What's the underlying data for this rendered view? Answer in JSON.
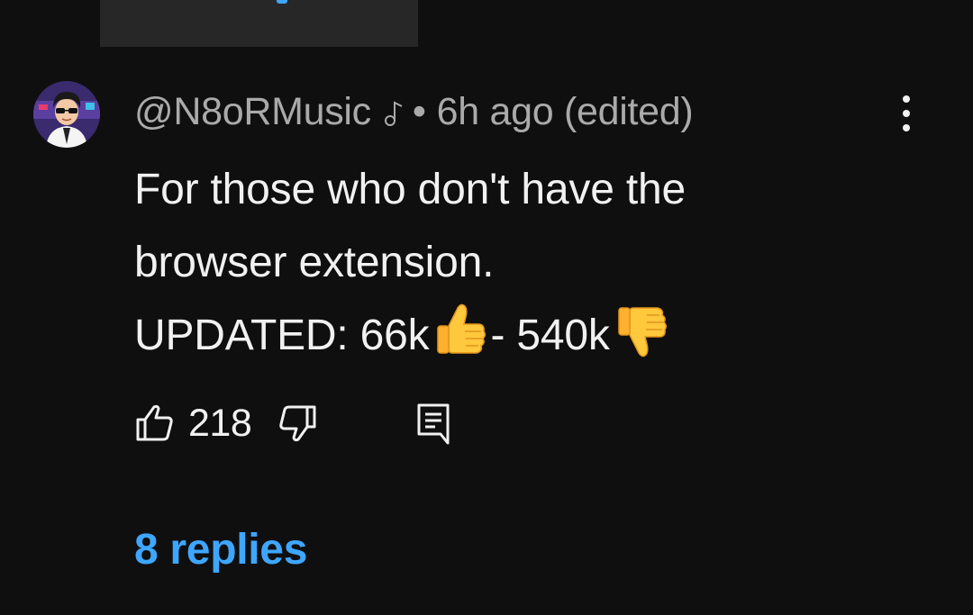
{
  "comment": {
    "author": "@N8oRMusic",
    "author_badge_icon": "music-note-icon",
    "separator": "•",
    "time": "6h ago (edited)",
    "body": {
      "line1": "For those who don't have the",
      "line2": "browser extension.",
      "line3_prefix": "UPDATED: 66k",
      "line3_middle": "- 540k",
      "emoji_1": "thumbs-up-emoji",
      "emoji_2": "thumbs-down-emoji"
    },
    "like_count": "218",
    "replies_label": "8 replies"
  },
  "colors": {
    "background": "#0f0f0f",
    "primary_text": "#f1f1f1",
    "secondary_text": "#aaaaaa",
    "link": "#3ea6ff"
  }
}
